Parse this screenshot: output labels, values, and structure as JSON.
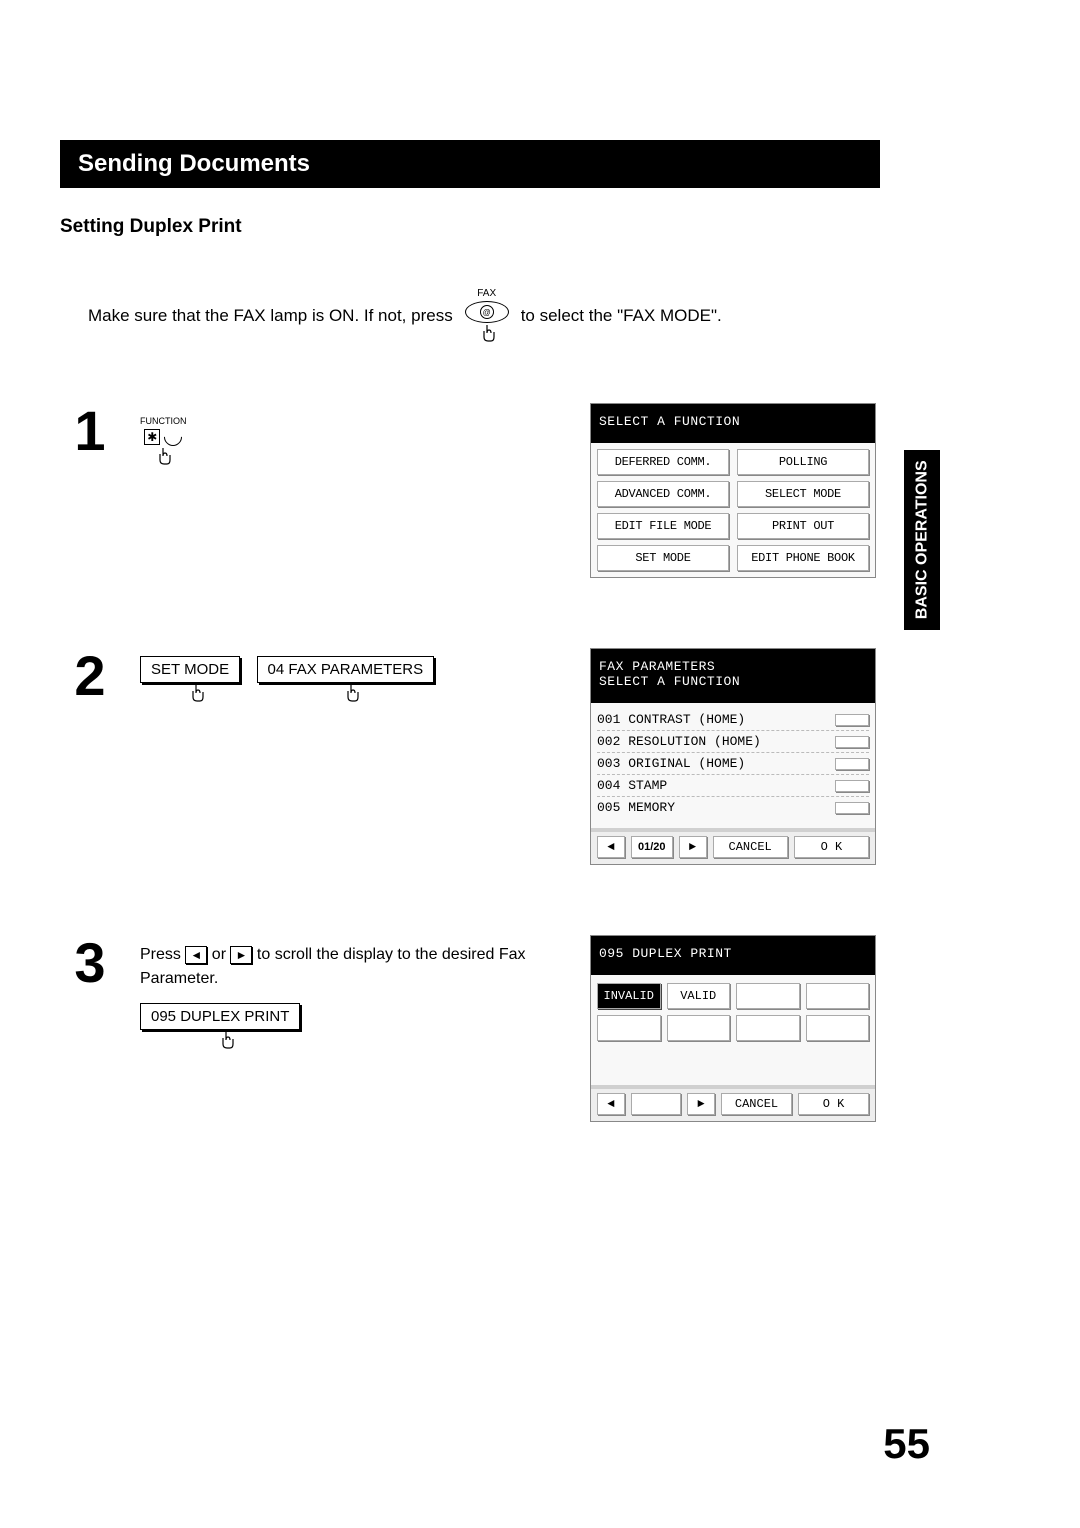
{
  "sidebar": {
    "label": "BASIC\nOPERATIONS"
  },
  "title": "Sending Documents",
  "subtitle": "Setting Duplex Print",
  "intro": {
    "part1": "Make sure that the FAX lamp is ON.  If not, press",
    "fax_label": "FAX",
    "part2": "to select the \"FAX MODE\"."
  },
  "steps": {
    "s1": {
      "num": "1",
      "function_label": "FUNCTION",
      "asterisk": "✱",
      "lcd": {
        "header": "SELECT A FUNCTION",
        "options": [
          "DEFERRED COMM.",
          "POLLING",
          "ADVANCED COMM.",
          "SELECT MODE",
          "EDIT FILE MODE",
          "PRINT OUT",
          "SET MODE",
          "EDIT PHONE BOOK"
        ]
      }
    },
    "s2": {
      "num": "2",
      "btn1": "SET MODE",
      "btn2": "04 FAX PARAMETERS",
      "lcd": {
        "header1": "FAX PARAMETERS",
        "header2": "SELECT A FUNCTION",
        "rows": [
          "001 CONTRAST (HOME)",
          "002 RESOLUTION (HOME)",
          "003 ORIGINAL (HOME)",
          "004 STAMP",
          "005 MEMORY"
        ],
        "page": "01/20",
        "cancel": "CANCEL",
        "ok": "O K"
      }
    },
    "s3": {
      "num": "3",
      "text1": "Press ",
      "text2": " or ",
      "text3": " to scroll the display to the desired Fax Parameter.",
      "btn": "095 DUPLEX PRINT",
      "lcd": {
        "header": "095 DUPLEX PRINT",
        "opt_invalid": "INVALID",
        "opt_valid": "VALID",
        "cancel": "CANCEL",
        "ok": "O K"
      }
    }
  },
  "page_number": "55"
}
